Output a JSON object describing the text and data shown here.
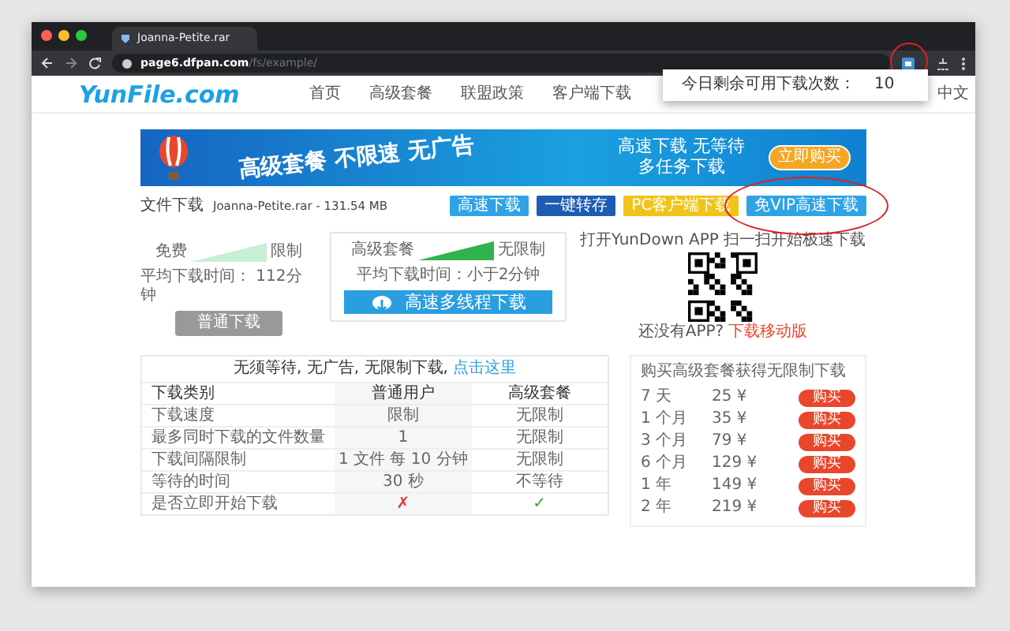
{
  "browser": {
    "tab_title": "Joanna-Petite.rar",
    "url_host": "page6.dfpan.com",
    "url_path": "/fs/example/",
    "extension_highlighted": true
  },
  "popup": {
    "label": "今日剩余可用下载次数：",
    "value": "10"
  },
  "site": {
    "logo": "YunFile.com",
    "nav": [
      "首页",
      "高级套餐",
      "联盟政策",
      "客户端下载"
    ],
    "language": "中文"
  },
  "banner": {
    "slogan": "高级套餐 不限速 无广告",
    "line_1": "高速下载 无等待",
    "line_2": "多任务下载",
    "button": "立即购买"
  },
  "file": {
    "label": "文件下载",
    "name": "Joanna-Petite.rar - 131.54 MB"
  },
  "download_buttons": [
    {
      "label": "高速下载",
      "kind": "light",
      "highlighted": false
    },
    {
      "label": "一键转存",
      "kind": "dark",
      "highlighted": false
    },
    {
      "label": "PC客户端下载",
      "kind": "yellow",
      "highlighted": false
    },
    {
      "label": "免VIP高速下载",
      "kind": "light",
      "highlighted": true
    }
  ],
  "free": {
    "label": "免费",
    "limit": "限制",
    "time": "平均下载时间： 112分钟",
    "button": "普通下载"
  },
  "premium": {
    "label": "高级套餐",
    "limit": "无限制",
    "time": "平均下载时间：小于2分钟",
    "button": "高速多线程下载"
  },
  "app": {
    "text": "打开YunDown APP 扫一扫开始极速下载",
    "question": "还没有APP?",
    "link": "下载移动版"
  },
  "table": {
    "promo": "无须等待, 无广告, 无限制下载,",
    "promo_link": "点击这里",
    "columns": [
      "下载类别",
      "普通用户",
      "高级套餐"
    ],
    "rows": [
      [
        "下载速度",
        "限制",
        "无限制"
      ],
      [
        "最多同时下载的文件数量",
        "1",
        "无限制"
      ],
      [
        "下载间隔限制",
        "1 文件 每 10 分钟",
        "无限制"
      ],
      [
        "等待的时间",
        "30 秒",
        "不等待"
      ],
      [
        "是否立即开始下载",
        "✗",
        "✓"
      ]
    ]
  },
  "plans": {
    "title": "购买高级套餐获得无限制下载",
    "items": [
      {
        "period": "7 天",
        "price": "25 ¥",
        "button": "购买"
      },
      {
        "period": "1 个月",
        "price": "35 ¥",
        "button": "购买"
      },
      {
        "period": "3 个月",
        "price": "79 ¥",
        "button": "购买"
      },
      {
        "period": "6 个月",
        "price": "129 ¥",
        "button": "购买"
      },
      {
        "period": "1 年",
        "price": "149 ¥",
        "button": "购买"
      },
      {
        "period": "2 年",
        "price": "219 ¥",
        "button": "购买"
      }
    ]
  }
}
